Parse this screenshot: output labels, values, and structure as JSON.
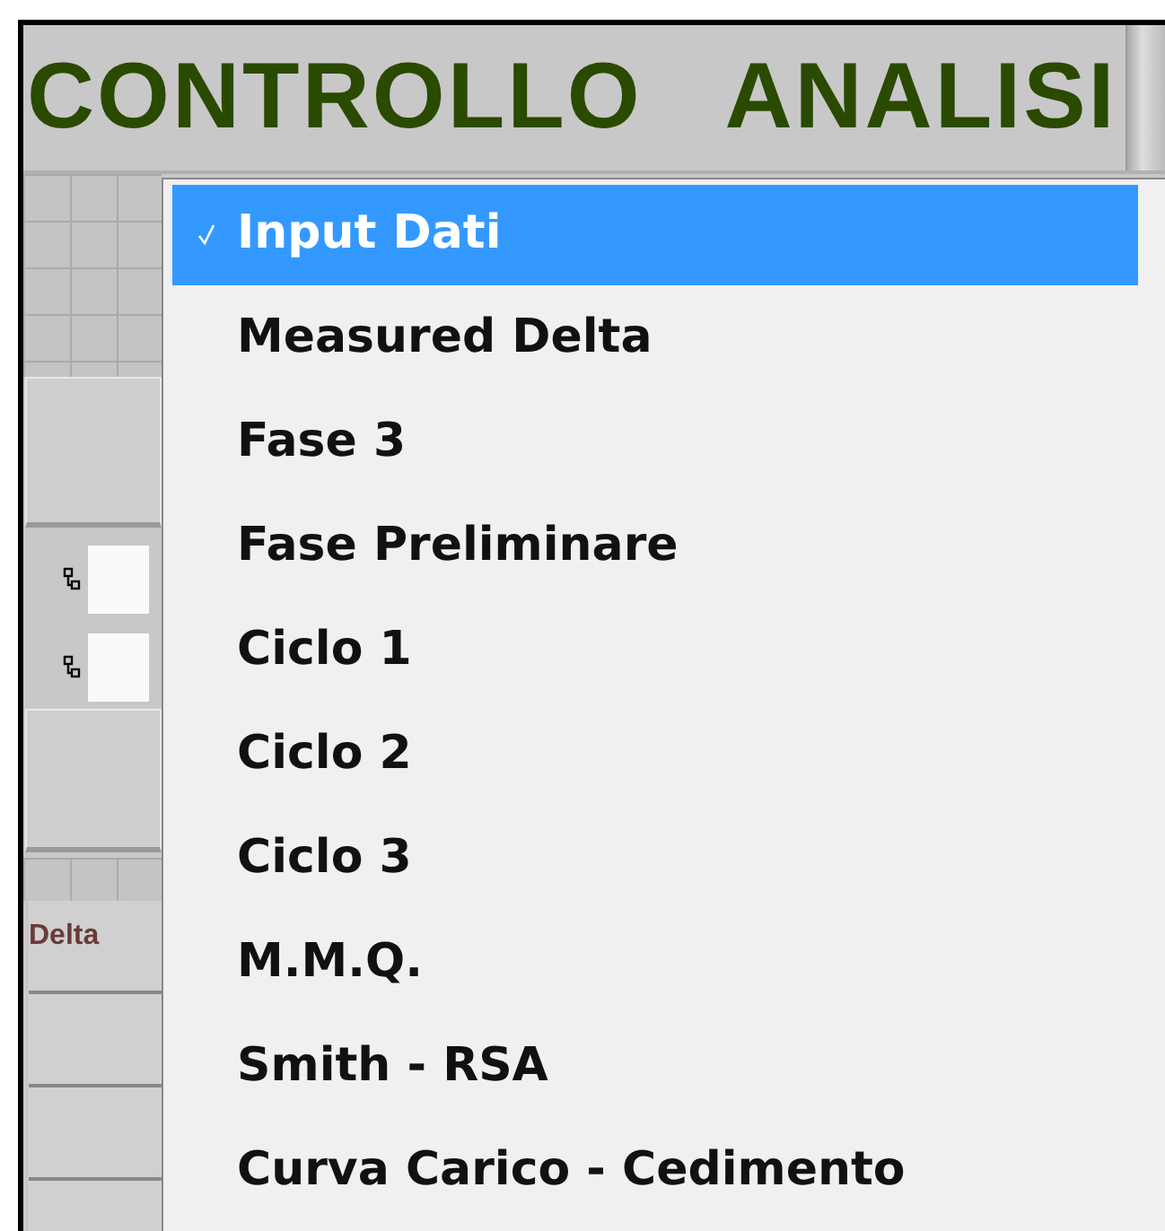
{
  "header": {
    "title": "CONTROLLO   ANALISI"
  },
  "side_panel": {
    "column_header": "Delta"
  },
  "menu": {
    "items": [
      {
        "label": "Input Dati",
        "selected": true
      },
      {
        "label": "Measured Delta",
        "selected": false
      },
      {
        "label": "Fase 3",
        "selected": false
      },
      {
        "label": "Fase Preliminare",
        "selected": false
      },
      {
        "label": "Ciclo 1",
        "selected": false
      },
      {
        "label": "Ciclo 2",
        "selected": false
      },
      {
        "label": "Ciclo 3",
        "selected": false
      },
      {
        "label": "M.M.Q.",
        "selected": false
      },
      {
        "label": "Smith - RSA",
        "selected": false
      },
      {
        "label": "Curva Carico - Cedimento",
        "selected": false
      }
    ]
  }
}
